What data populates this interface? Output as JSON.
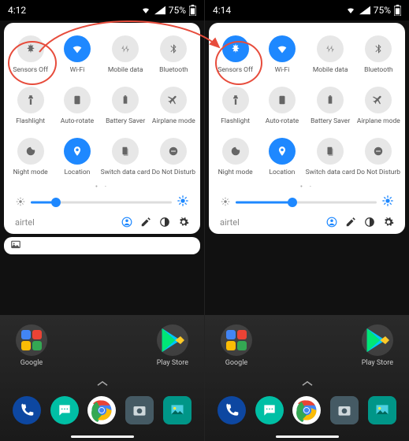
{
  "left": {
    "statusbar": {
      "time": "4:12",
      "battery": "75%"
    },
    "tiles": [
      {
        "key": "sensors",
        "label": "Sensors Off",
        "on": false
      },
      {
        "key": "wifi",
        "label": "Wi-Fi",
        "on": true
      },
      {
        "key": "mobile",
        "label": "Mobile data",
        "on": false
      },
      {
        "key": "bt",
        "label": "Bluetooth",
        "on": false
      },
      {
        "key": "flash",
        "label": "Flashlight",
        "on": false
      },
      {
        "key": "rotate",
        "label": "Auto-rotate",
        "on": false
      },
      {
        "key": "battery",
        "label": "Battery Saver",
        "on": false
      },
      {
        "key": "airplane",
        "label": "Airplane mode",
        "on": false
      },
      {
        "key": "night",
        "label": "Night mode",
        "on": false
      },
      {
        "key": "location",
        "label": "Location",
        "on": true
      },
      {
        "key": "sim",
        "label": "Switch data card",
        "on": false
      },
      {
        "key": "dnd",
        "label": "Do Not Disturb",
        "on": false
      }
    ],
    "slider_pct": 18,
    "carrier": "airtel"
  },
  "right": {
    "statusbar": {
      "time": "4:14",
      "battery": "75%"
    },
    "tiles": [
      {
        "key": "sensors",
        "label": "Sensors Off",
        "on": true
      },
      {
        "key": "wifi",
        "label": "Wi-Fi",
        "on": true
      },
      {
        "key": "mobile",
        "label": "Mobile data",
        "on": false
      },
      {
        "key": "bt",
        "label": "Bluetooth",
        "on": false
      },
      {
        "key": "flash",
        "label": "Flashlight",
        "on": false
      },
      {
        "key": "rotate",
        "label": "Auto-rotate",
        "on": false
      },
      {
        "key": "battery",
        "label": "Battery Saver",
        "on": false
      },
      {
        "key": "airplane",
        "label": "Airplane mode",
        "on": false
      },
      {
        "key": "night",
        "label": "Night mode",
        "on": false
      },
      {
        "key": "location",
        "label": "Location",
        "on": true
      },
      {
        "key": "sim",
        "label": "Switch data card",
        "on": false
      },
      {
        "key": "dnd",
        "label": "Do Not Disturb",
        "on": false
      }
    ],
    "slider_pct": 40,
    "carrier": "airtel"
  },
  "home": {
    "folders": [
      {
        "label": "Google"
      },
      {
        "label": "Play Store"
      }
    ]
  }
}
